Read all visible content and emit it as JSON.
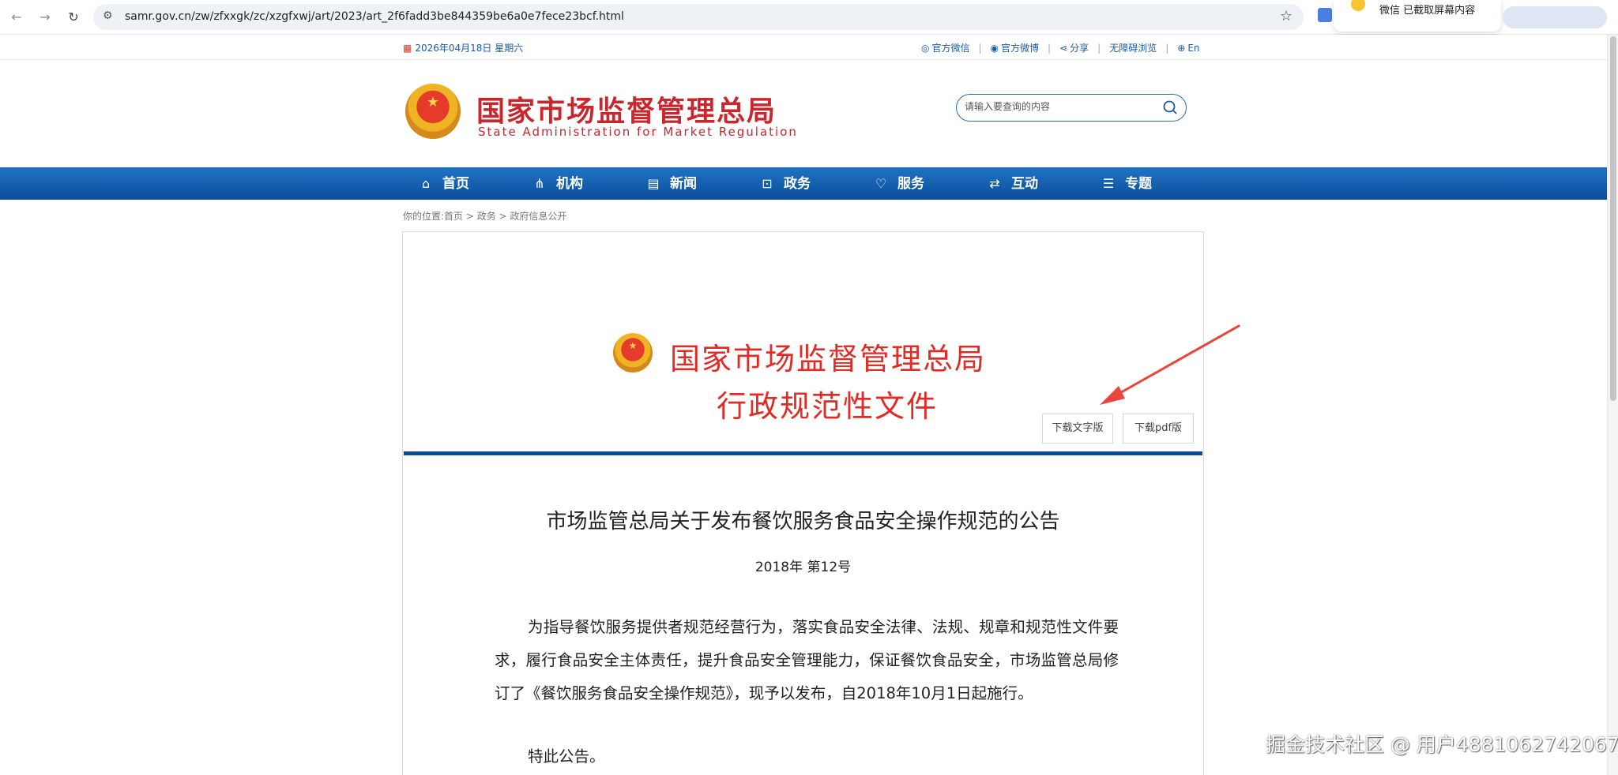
{
  "browser": {
    "url": "samr.gov.cn/zw/zfxxgk/zc/xzgfxwj/art/2023/art_2f6fadd3be844359be6a0e7fece23bcf.html",
    "toast": "微信 已截取屏幕内容"
  },
  "utility": {
    "date": "2026年04月18日 星期六",
    "links": [
      "官方微信",
      "官方微博",
      "分享",
      "无障碍浏览",
      "En"
    ]
  },
  "header": {
    "name_cn": "国家市场监督管理总局",
    "name_en": "State Administration for Market Regulation",
    "search_placeholder": "请输入要查询的内容"
  },
  "nav": {
    "items": [
      {
        "label": "首页",
        "icon": "home-icon"
      },
      {
        "label": "机构",
        "icon": "org-icon"
      },
      {
        "label": "新闻",
        "icon": "news-icon"
      },
      {
        "label": "政务",
        "icon": "affairs-icon"
      },
      {
        "label": "服务",
        "icon": "heart-icon"
      },
      {
        "label": "互动",
        "icon": "exchange-icon"
      },
      {
        "label": "专题",
        "icon": "list-icon"
      }
    ]
  },
  "breadcrumb": "你的位置:首页 > 政务 > 政府信息公开",
  "document": {
    "head_line1": "国家市场监督管理总局",
    "head_line2": "行政规范性文件",
    "download_text": "下载文字版",
    "download_pdf": "下载pdf版",
    "title": "市场监管总局关于发布餐饮服务食品安全操作规范的公告",
    "number": "2018年 第12号",
    "paragraph": "为指导餐饮服务提供者规范经营行为，落实食品安全法律、法规、规章和规范性文件要求，履行食品安全主体责任，提升食品安全管理能力，保证餐饮食品安全，市场监管总局修订了《餐饮服务食品安全操作规范》，现予以发布，自2018年10月1日起施行。",
    "closing": "特此公告。"
  },
  "watermark": "掘金技术社区 @ 用户4881062742067",
  "colors": {
    "brand_red": "#c9272d",
    "nav_blue": "#0c4d9a",
    "doc_red": "#e22b25"
  }
}
